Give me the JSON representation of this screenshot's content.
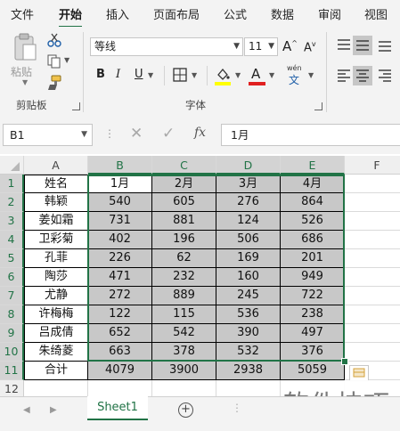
{
  "ribbon_tabs": [
    "文件",
    "开始",
    "插入",
    "页面布局",
    "公式",
    "数据",
    "审阅",
    "视图"
  ],
  "clipboard": {
    "paste_label": "粘贴",
    "group_label": "剪贴板"
  },
  "font": {
    "name": "等线",
    "size": "11",
    "group_label": "字体",
    "grow": "A",
    "shrink": "A",
    "bold": "B",
    "italic": "I",
    "underline": "U",
    "font_color_letter": "A",
    "phonetic_top": "wén",
    "phonetic_bottom": "文"
  },
  "formula_bar": {
    "name_box": "B1",
    "fx": "fx",
    "value": "1月"
  },
  "columns": [
    "A",
    "B",
    "C",
    "D",
    "E",
    "F"
  ],
  "rows": [
    "1",
    "2",
    "3",
    "4",
    "5",
    "6",
    "7",
    "8",
    "9",
    "10",
    "11",
    "12",
    "13"
  ],
  "table": {
    "header": [
      "姓名",
      "1月",
      "2月",
      "3月",
      "4月"
    ],
    "body": [
      [
        "韩颖",
        "540",
        "605",
        "276",
        "864"
      ],
      [
        "姜如霜",
        "731",
        "881",
        "124",
        "526"
      ],
      [
        "卫彩菊",
        "402",
        "196",
        "506",
        "686"
      ],
      [
        "孔菲",
        "226",
        "62",
        "169",
        "201"
      ],
      [
        "陶莎",
        "471",
        "232",
        "160",
        "949"
      ],
      [
        "尤静",
        "272",
        "889",
        "245",
        "722"
      ],
      [
        "许梅梅",
        "122",
        "115",
        "536",
        "238"
      ],
      [
        "吕成倩",
        "652",
        "542",
        "390",
        "497"
      ],
      [
        "朱绮菱",
        "663",
        "378",
        "532",
        "376"
      ],
      [
        "合计",
        "4079",
        "3900",
        "2938",
        "5059"
      ]
    ]
  },
  "sheet_tab": "Sheet1",
  "watermark": "软件技巧",
  "colors": {
    "accent": "#217346",
    "selection_fill": "#c8c8c8"
  }
}
